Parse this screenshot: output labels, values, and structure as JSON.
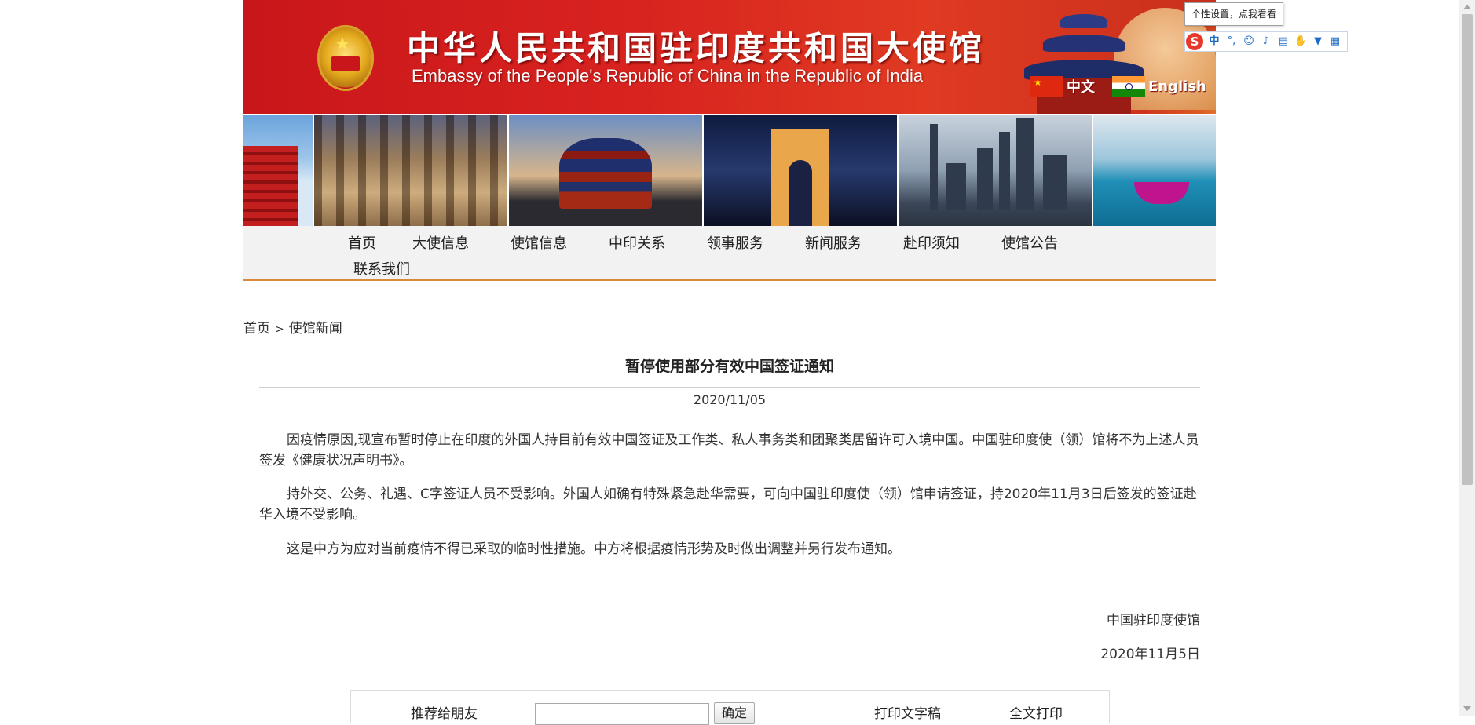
{
  "header": {
    "title_cn": "中华人民共和国驻印度共和国大使馆",
    "title_en": "Embassy of the People's Republic of China in the Republic of India",
    "lang_cn": "中文",
    "lang_en": "English"
  },
  "nav": {
    "items": [
      {
        "label": "首页"
      },
      {
        "label": "大使信息"
      },
      {
        "label": "使馆信息"
      },
      {
        "label": "中印关系"
      },
      {
        "label": "领事服务"
      },
      {
        "label": "新闻服务"
      },
      {
        "label": "赴印须知"
      },
      {
        "label": "使馆公告"
      },
      {
        "label": "联系我们"
      }
    ]
  },
  "breadcrumb": {
    "home": "首页",
    "separator": ">",
    "current": "使馆新闻"
  },
  "article": {
    "title": "暂停使用部分有效中国签证通知",
    "date": "2020/11/05",
    "paragraphs": [
      "因疫情原因,现宣布暂时停止在印度的外国人持目前有效中国签证及工作类、私人事务类和团聚类居留许可入境中国。中国驻印度使（领）馆将不为上述人员签发《健康状况声明书》。",
      "持外交、公务、礼遇、C字签证人员不受影响。外国人如确有特殊紧急赴华需要，可向中国驻印度使（领）馆申请签证，持2020年11月3日后签发的签证赴华入境不受影响。",
      "这是中方为应对当前疫情不得已采取的临时性措施。中方将根据疫情形势及时做出调整并另行发布通知。"
    ],
    "signature_org": "中国驻印度使馆",
    "signature_date": "2020年11月5日"
  },
  "share": {
    "recommend_label": "推荐给朋友",
    "email_value": "",
    "confirm_label": "确定",
    "print_text": "打印文字稿",
    "print_full": "全文打印"
  },
  "ime": {
    "tooltip": "个性设置，点我看看",
    "logo": "S",
    "mode_label": "中",
    "punct": "°,",
    "icons": [
      "emoji-icon",
      "microphone-icon",
      "keyboard-icon",
      "hand-icon",
      "skin-icon",
      "grid-icon"
    ]
  },
  "colors": {
    "banner_red": "#d8231f",
    "nav_rule": "#d88a3d"
  }
}
